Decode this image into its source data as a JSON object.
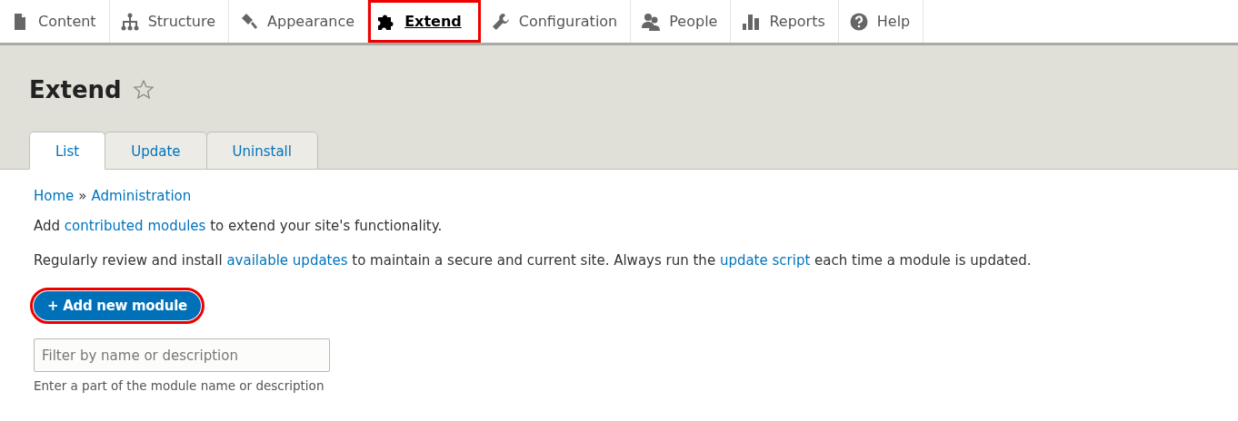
{
  "toolbar": [
    {
      "label": "Content",
      "selected": false,
      "highlighted": false
    },
    {
      "label": "Structure",
      "selected": false,
      "highlighted": false
    },
    {
      "label": "Appearance",
      "selected": false,
      "highlighted": false
    },
    {
      "label": "Extend",
      "selected": true,
      "highlighted": true
    },
    {
      "label": "Configuration",
      "selected": false,
      "highlighted": false
    },
    {
      "label": "People",
      "selected": false,
      "highlighted": false
    },
    {
      "label": "Reports",
      "selected": false,
      "highlighted": false
    },
    {
      "label": "Help",
      "selected": false,
      "highlighted": false
    }
  ],
  "page_title": "Extend",
  "tabs": [
    {
      "label": "List",
      "selected": true
    },
    {
      "label": "Update",
      "selected": false
    },
    {
      "label": "Uninstall",
      "selected": false
    }
  ],
  "breadcrumb": [
    {
      "label": "Home"
    },
    {
      "label": "Administration"
    }
  ],
  "breadcrumb_separator": "»",
  "paragraphs": [
    [
      {
        "text": "Add "
      },
      {
        "text": "contributed modules",
        "link": true
      },
      {
        "text": " to extend your site's functionality."
      }
    ],
    [
      {
        "text": "Regularly review and install "
      },
      {
        "text": "available updates",
        "link": true
      },
      {
        "text": " to maintain a secure and current site. Always run the "
      },
      {
        "text": "update script",
        "link": true
      },
      {
        "text": " each time a module is updated."
      }
    ]
  ],
  "add_button": {
    "label": "+ Add new module",
    "highlighted": true
  },
  "filter": {
    "placeholder": "Filter by name or description",
    "description": "Enter a part of the module name or description"
  }
}
